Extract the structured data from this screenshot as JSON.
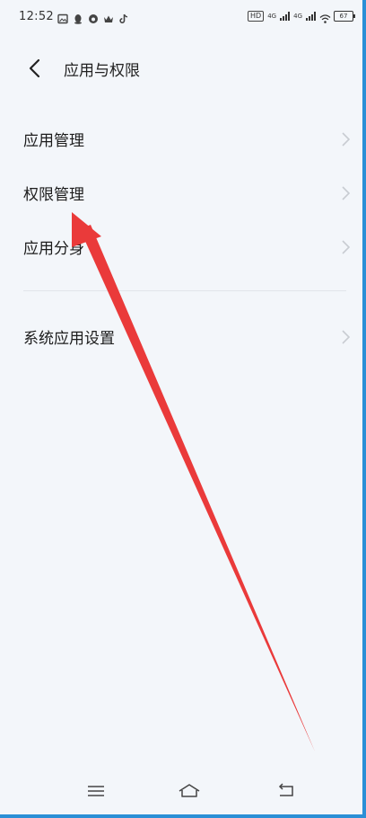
{
  "status_bar": {
    "time": "12:52",
    "left_icons": [
      "gallery-icon",
      "qq-penguin-icon",
      "weibo-icon",
      "crown-icon",
      "tiktok-icon"
    ],
    "hd_badge": "HD",
    "network_1": "4G",
    "network_2": "4G",
    "battery": "67"
  },
  "header": {
    "title": "应用与权限"
  },
  "list": {
    "items": [
      {
        "label": "应用管理"
      },
      {
        "label": "权限管理"
      },
      {
        "label": "应用分身"
      },
      {
        "label": "系统应用设置"
      }
    ]
  },
  "annotation": {
    "color": "#ea3a3a"
  },
  "colors": {
    "background": "#f3f6fa",
    "frame_accent": "#2b8fd6",
    "chevron": "#c8ccd2"
  }
}
